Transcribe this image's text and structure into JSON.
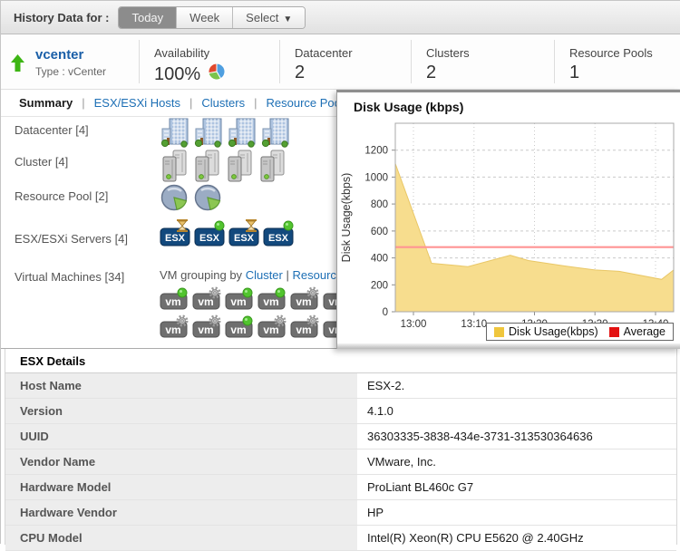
{
  "top_bar": {
    "label": "History Data for :",
    "buttons": [
      {
        "label": "Today",
        "selected": true
      },
      {
        "label": "Week",
        "selected": false
      },
      {
        "label": "Select",
        "selected": false,
        "dropdown": true
      }
    ],
    "dropdown_arrow": "▼"
  },
  "header": {
    "status_icon": "green-up-arrow",
    "title": "vcenter",
    "subtitle": "Type : vCenter",
    "availability": {
      "label": "Availability",
      "value": "100%",
      "icon": "pie-chart"
    },
    "metrics": [
      {
        "label": "Datacenter",
        "value": "2"
      },
      {
        "label": "Clusters",
        "value": "2"
      },
      {
        "label": "Resource Pools",
        "value": "1"
      }
    ]
  },
  "tabs": {
    "separator": "|",
    "items": [
      {
        "label": "Summary",
        "active": true
      },
      {
        "label": "ESX/ESXi Hosts",
        "active": false
      },
      {
        "label": "Clusters",
        "active": false
      },
      {
        "label": "Resource Pools",
        "active": false
      }
    ]
  },
  "summary": {
    "rows": [
      {
        "label": "Datacenter",
        "count": "[4]",
        "icons": [
          "building",
          "building",
          "building",
          "building"
        ]
      },
      {
        "label": "Cluster",
        "count": "[4]",
        "icons": [
          "server",
          "server",
          "server",
          "server"
        ]
      },
      {
        "label": "Resource Pool",
        "count": "[2]",
        "icons": [
          "pool",
          "pool"
        ]
      },
      {
        "label": "ESX/ESXi Servers",
        "count": "[4]",
        "icons": [
          "esx-hourglass",
          "esx-dot",
          "esx-hourglass",
          "esx-dot"
        ]
      },
      {
        "label": "Virtual Machines",
        "count": "[34]"
      }
    ],
    "vm_grouping": {
      "prefix": "VM grouping by",
      "link1": "Cluster",
      "separator": "|",
      "link2": "Resource"
    },
    "vm_rows": [
      [
        "vm-dot",
        "vm-gear",
        "vm-dot",
        "vm-dot",
        "vm-gear",
        "vm-dot"
      ],
      [
        "vm-gear",
        "vm-gear",
        "vm-dot",
        "vm-gear",
        "vm-gear",
        "vm-gear"
      ]
    ]
  },
  "chart_data": {
    "type": "area",
    "title": "Disk Usage (kbps)",
    "ylabel": "Disk Usage(kbps)",
    "x_ticks": [
      "13:00",
      "13:10",
      "13:20",
      "13:30",
      "13:40"
    ],
    "x_tick_minutes": [
      0,
      10,
      20,
      30,
      40
    ],
    "x_range_minutes": [
      -3,
      43
    ],
    "ylim": [
      0,
      1400
    ],
    "y_ticks": [
      0,
      200,
      400,
      600,
      800,
      1000,
      1200
    ],
    "grid": "dashed",
    "series": [
      {
        "name": "Disk Usage(kbps)",
        "type": "area",
        "fill": "#f7dd8e",
        "stroke": "#e9c766",
        "points": [
          {
            "m": -3,
            "v": 1100
          },
          {
            "m": 3,
            "v": 360
          },
          {
            "m": 9,
            "v": 335
          },
          {
            "m": 16,
            "v": 420
          },
          {
            "m": 19,
            "v": 380
          },
          {
            "m": 25,
            "v": 340
          },
          {
            "m": 30,
            "v": 310
          },
          {
            "m": 34,
            "v": 300
          },
          {
            "m": 41,
            "v": 240
          },
          {
            "m": 43,
            "v": 310
          }
        ]
      },
      {
        "name": "Average",
        "type": "hline",
        "color": "#ff9494",
        "value": 480
      }
    ],
    "legend": [
      {
        "label": "Disk Usage(kbps)",
        "color": "#efc63d"
      },
      {
        "label": "Average",
        "color": "#e31212"
      }
    ],
    "legend_position": "bottom-right"
  },
  "details": {
    "title": "ESX Details",
    "rows": [
      {
        "label": "Host Name",
        "value": "ESX-2."
      },
      {
        "label": "Version",
        "value": "4.1.0"
      },
      {
        "label": "UUID",
        "value": "36303335-3838-434e-3731-313530364636"
      },
      {
        "label": "Vendor Name",
        "value": "VMware, Inc."
      },
      {
        "label": "Hardware Model",
        "value": "ProLiant BL460c G7"
      },
      {
        "label": "Hardware Vendor",
        "value": "HP"
      },
      {
        "label": "CPU Model",
        "value": "Intel(R) Xeon(R) CPU E5620 @ 2.40GHz"
      }
    ]
  }
}
